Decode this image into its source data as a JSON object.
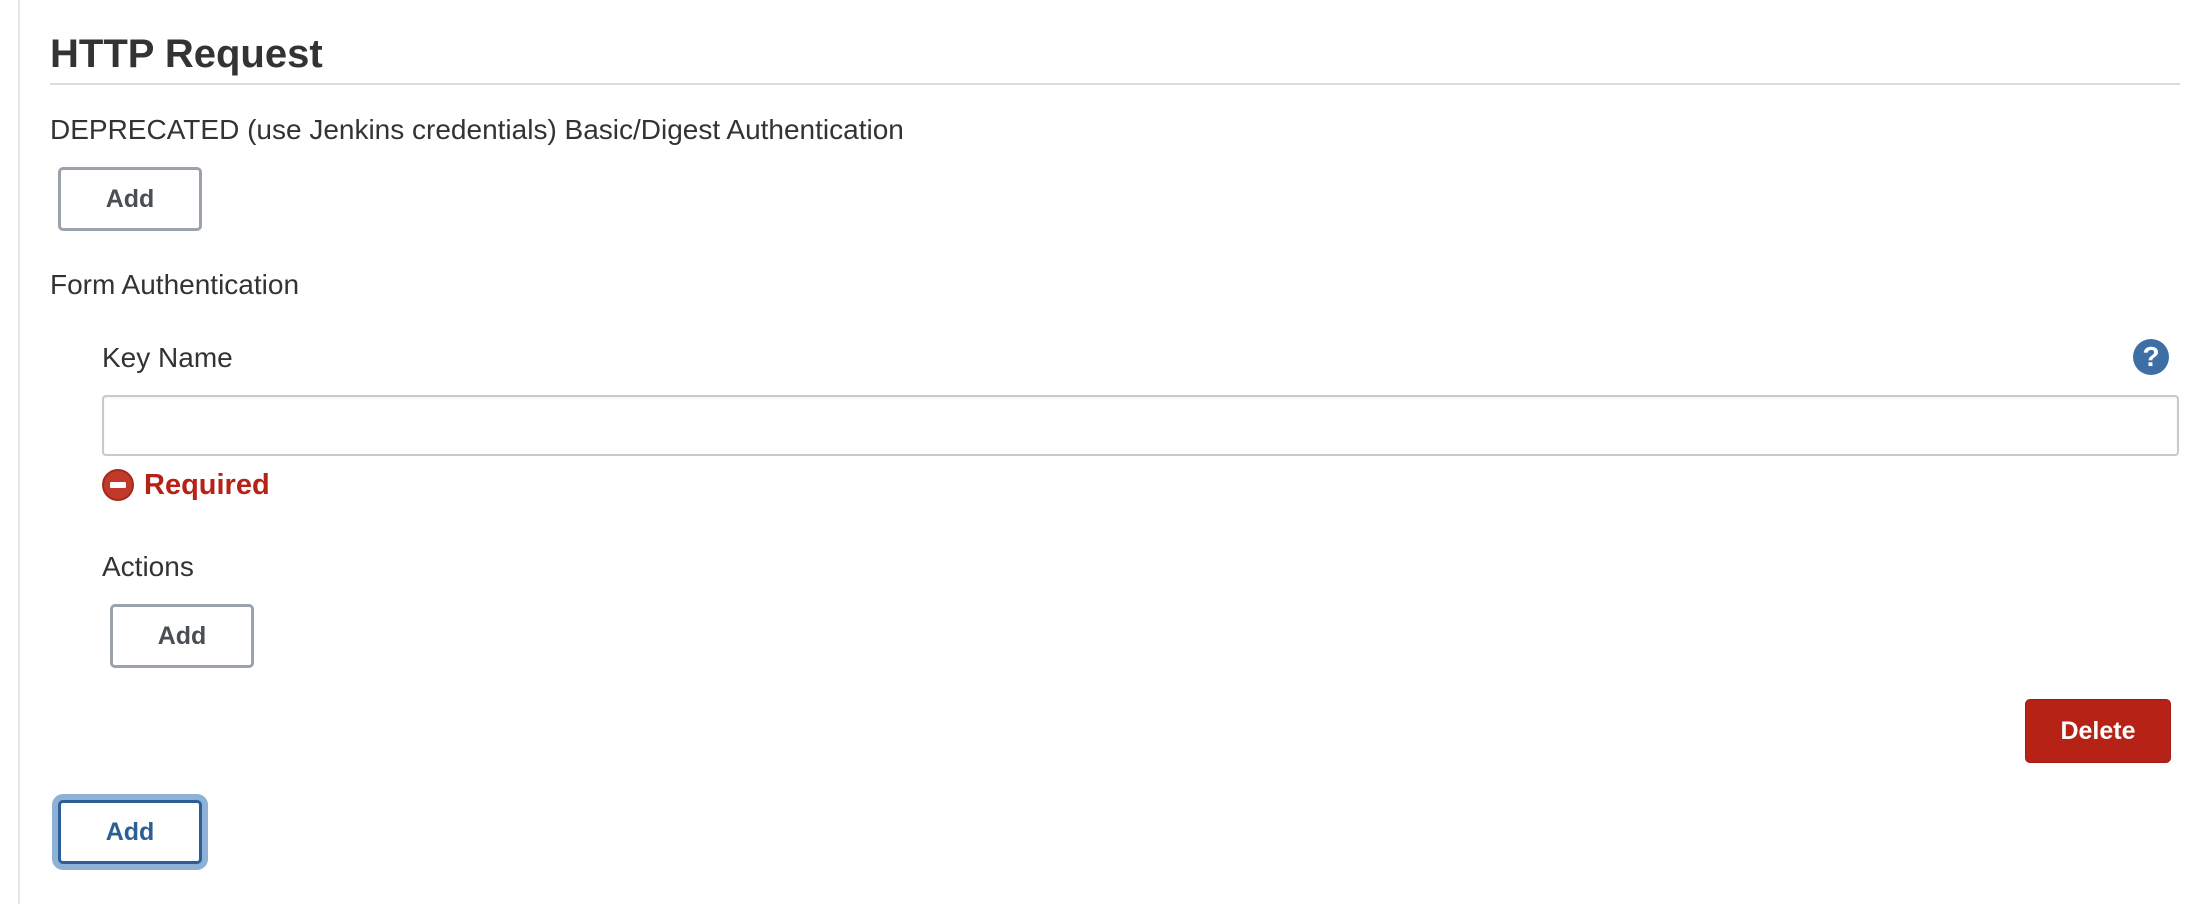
{
  "section": {
    "title": "HTTP Request"
  },
  "basic_auth": {
    "label": "DEPRECATED (use Jenkins credentials) Basic/Digest Authentication",
    "add_button": "Add"
  },
  "form_auth": {
    "label": "Form Authentication",
    "key_name": {
      "label": "Key Name",
      "value": "",
      "placeholder": "",
      "help_icon": "question-mark-icon",
      "error_icon": "error-circle-icon",
      "error_text": "Required"
    },
    "actions": {
      "label": "Actions",
      "add_button": "Add"
    },
    "delete_button": "Delete"
  },
  "footer": {
    "add_button": "Add"
  },
  "colors": {
    "accent": "#2d5f95",
    "danger": "#b62216",
    "help": "#3d6fa6",
    "text": "#333333"
  }
}
